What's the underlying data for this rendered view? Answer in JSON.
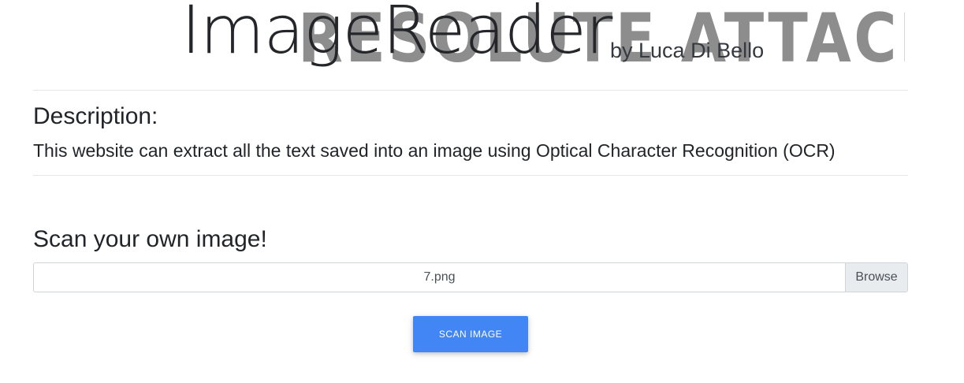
{
  "header": {
    "title": "ImageReader",
    "byline": "by Luca Di Bello",
    "watermark": "RESOLUTE ATTACK"
  },
  "description": {
    "heading": "Description:",
    "text": "This website can extract all the text saved into an image using Optical Character Recognition (OCR)"
  },
  "scan": {
    "heading": "Scan your own image!",
    "file_name": "7.png",
    "browse_label": "Browse",
    "button_label": "SCAN IMAGE"
  },
  "colors": {
    "button_bg": "#4285f4",
    "watermark": "#8d8d8d",
    "browse_bg": "#e9ecef"
  }
}
